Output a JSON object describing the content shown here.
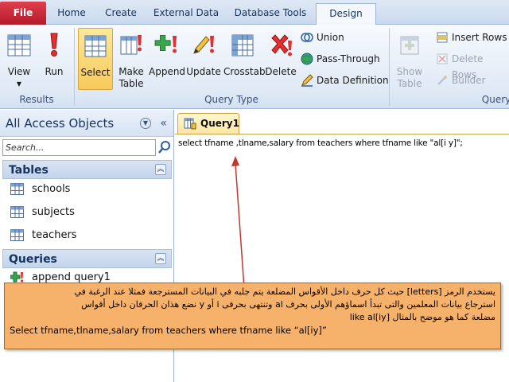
{
  "ribbon": {
    "tabs": [
      "File",
      "Home",
      "Create",
      "External Data",
      "Database Tools",
      "Design"
    ],
    "active_tab": "Design",
    "groups": {
      "results": {
        "label": "Results",
        "view": "View",
        "run": "Run"
      },
      "query_type": {
        "label": "Query Type",
        "select": "Select",
        "make_table_1": "Make",
        "make_table_2": "Table",
        "append": "Append",
        "update": "Update",
        "crosstab": "Crosstab",
        "delete": "Delete",
        "union": "Union",
        "pass_through": "Pass-Through",
        "data_definition": "Data Definition"
      },
      "query_setup": {
        "label": "Query",
        "show_table_1": "Show",
        "show_table_2": "Table",
        "insert_rows": "Insert Rows",
        "delete_rows": "Delete Rows",
        "builder": "Builder"
      }
    }
  },
  "nav": {
    "title": "All Access Objects",
    "search_placeholder": "Search...",
    "tables_header": "Tables",
    "tables": [
      "schools",
      "subjects",
      "teachers"
    ],
    "queries_header": "Queries",
    "queries": [
      "append query1"
    ]
  },
  "doc": {
    "tab_label": "Query1",
    "sql": "select tfname ,tlname,salary from teachers where tfname like \"al[i y]\";"
  },
  "annotation": {
    "line1": "يستخدم الرمز [letters] حيث كل حرف داخل الأقواس المضلعة يتم جلبه في البيانات المسترجعة فمثلا عند الرغبة في",
    "line2": "استرجاع بيانات المعلمين والتى تبدأ اسماؤهم الأولى بحرف al وتنتهى بحرفى i أو y نضع هذان الحرفان داخل أقواس",
    "line3": "مضلعة كما هو موضح بالمثال like al[iy]",
    "line4": "Select tfname,tlname,salary from teachers where tfname like “al[iy]”"
  },
  "colors": {
    "file_tab": "#c4202f",
    "select_highlight": "#f8c95a",
    "annotation_bg": "#f6b26b",
    "arrow": "#c0392b"
  }
}
